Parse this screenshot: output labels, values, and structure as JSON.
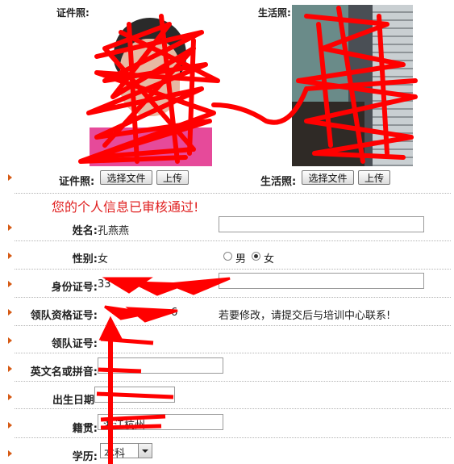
{
  "photos": {
    "id_photo_label": "证件照:",
    "life_photo_label": "生活照:"
  },
  "upload": {
    "id_label": "证件照:",
    "life_label": "生活照:",
    "choose_file": "选择文件",
    "upload": "上传"
  },
  "status_message": "您的个人信息已审核通过!",
  "fields": {
    "name": {
      "label": "姓名:",
      "value": "孔燕燕"
    },
    "gender": {
      "label": "性别:",
      "value": "女",
      "option_male": "男",
      "option_female": "女",
      "selected": "女"
    },
    "id_number": {
      "label": "身份证号:",
      "value": "33"
    },
    "leader_cert_no": {
      "label": "领队资格证号:",
      "value": "6"
    },
    "contact_note": "若要修改，请提交后与培训中心联系!",
    "leader_no": {
      "label": "领队证号:",
      "value": ""
    },
    "english_name": {
      "label": "英文名或拼音:",
      "value": ""
    },
    "birth_date": {
      "label": "出生日期",
      "value": ""
    },
    "native_place": {
      "label": "籍贯:",
      "value": "浙江杭州"
    },
    "education": {
      "label": "学历:",
      "value": "本科"
    }
  },
  "colors": {
    "scribble": "#ff0000",
    "status_text": "#e02020",
    "arrow": "#d65a14"
  }
}
